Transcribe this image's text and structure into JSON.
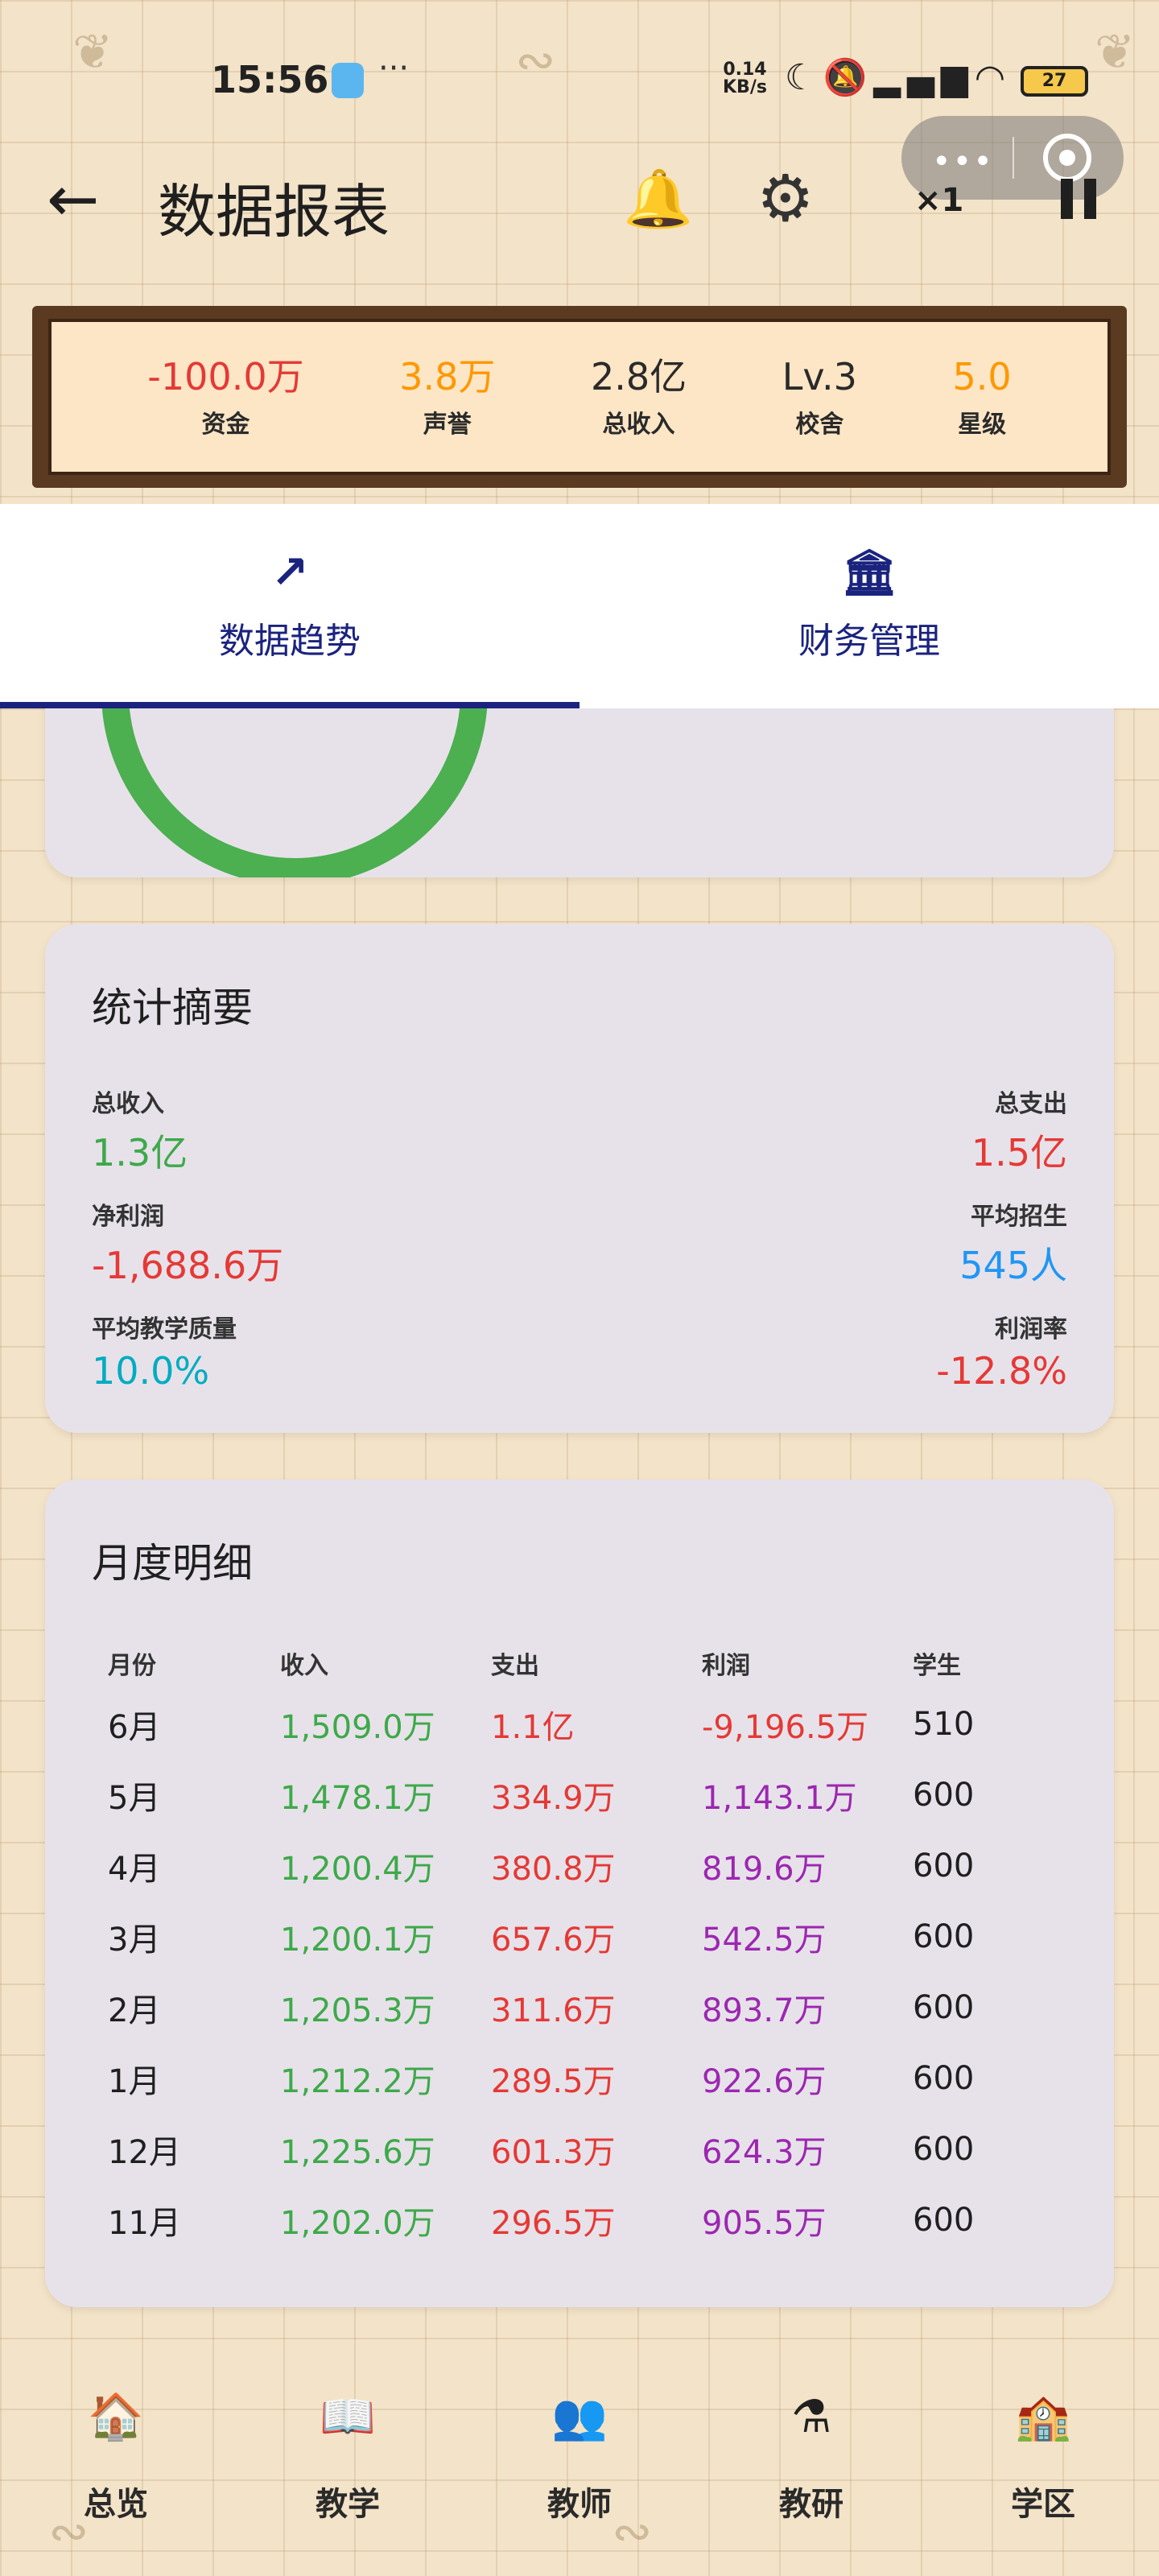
{
  "status_bar": {
    "time": "15:56",
    "more": "···",
    "net_speed_value": "0.14",
    "net_speed_unit": "KB/s",
    "battery": "27"
  },
  "capsule": {
    "more": "•••"
  },
  "header": {
    "title": "数据报表",
    "speed": "×1"
  },
  "resources": [
    {
      "value": "-100.0万",
      "label": "资金",
      "color": "#e53935"
    },
    {
      "value": "3.8万",
      "label": "声誉",
      "color": "#ff9800"
    },
    {
      "value": "2.8亿",
      "label": "总收入",
      "color": "#2a2a2a"
    },
    {
      "value": "Lv.3",
      "label": "校舍",
      "color": "#2a2a2a"
    },
    {
      "value": "5.0",
      "label": "星级",
      "color": "#ff9800"
    }
  ],
  "tabs": [
    {
      "icon": "↗",
      "label": "数据趋势",
      "active": true
    },
    {
      "icon": "🏛",
      "label": "财务管理",
      "active": false
    }
  ],
  "summary": {
    "title": "统计摘要",
    "items": [
      {
        "label": "总收入",
        "value": "1.3亿",
        "color": "#3ea94a"
      },
      {
        "label": "总支出",
        "value": "1.5亿",
        "color": "#e53935"
      },
      {
        "label": "净利润",
        "value": "-1,688.6万",
        "color": "#e53935"
      },
      {
        "label": "平均招生",
        "value": "545人",
        "color": "#2196f3"
      },
      {
        "label": "平均教学质量",
        "value": "10.0%",
        "color": "#00acc1"
      },
      {
        "label": "利润率",
        "value": "-12.8%",
        "color": "#e53935"
      }
    ]
  },
  "monthly": {
    "title": "月度明细",
    "headers": [
      "月份",
      "收入",
      "支出",
      "利润",
      "学生"
    ],
    "rows": [
      {
        "month": "6月",
        "income": "1,509.0万",
        "expense": "1.1亿",
        "profit": "-9,196.5万",
        "students": "510"
      },
      {
        "month": "5月",
        "income": "1,478.1万",
        "expense": "334.9万",
        "profit": "1,143.1万",
        "students": "600"
      },
      {
        "month": "4月",
        "income": "1,200.4万",
        "expense": "380.8万",
        "profit": "819.6万",
        "students": "600"
      },
      {
        "month": "3月",
        "income": "1,200.1万",
        "expense": "657.6万",
        "profit": "542.5万",
        "students": "600"
      },
      {
        "month": "2月",
        "income": "1,205.3万",
        "expense": "311.6万",
        "profit": "893.7万",
        "students": "600"
      },
      {
        "month": "1月",
        "income": "1,212.2万",
        "expense": "289.5万",
        "profit": "922.6万",
        "students": "600"
      },
      {
        "month": "12月",
        "income": "1,225.6万",
        "expense": "601.3万",
        "profit": "624.3万",
        "students": "600"
      },
      {
        "month": "11月",
        "income": "1,202.0万",
        "expense": "296.5万",
        "profit": "905.5万",
        "students": "600"
      }
    ]
  },
  "bottom_nav": [
    {
      "icon": "🏠",
      "icon_name": "school-house-icon",
      "label": "总览"
    },
    {
      "icon": "📖",
      "icon_name": "book-icon",
      "label": "教学"
    },
    {
      "icon": "👥",
      "icon_name": "teachers-icon",
      "label": "教师"
    },
    {
      "icon": "⚗",
      "icon_name": "flask-icon",
      "label": "教研"
    },
    {
      "icon": "🏫",
      "icon_name": "campus-icon",
      "label": "学区"
    }
  ]
}
